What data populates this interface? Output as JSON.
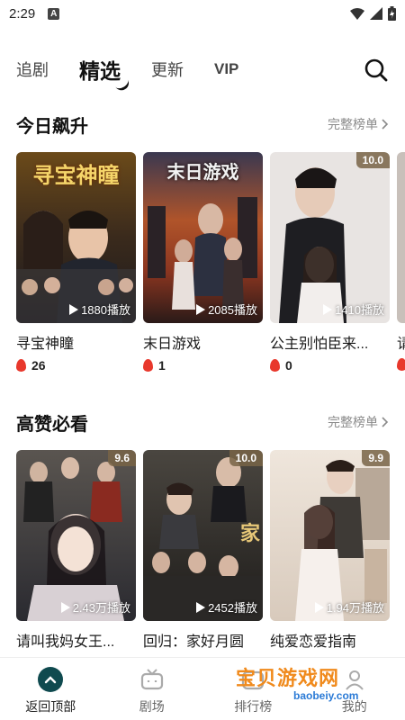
{
  "status": {
    "time": "2:29",
    "indicator": "A"
  },
  "tabs": [
    {
      "label": "追剧",
      "active": false
    },
    {
      "label": "精选",
      "active": true
    },
    {
      "label": "更新",
      "active": false
    },
    {
      "label": "VIP",
      "active": false
    }
  ],
  "sections": [
    {
      "title": "今日飙升",
      "more": "完整榜单",
      "cards": [
        {
          "title": "寻宝神瞳",
          "poster_text": "寻宝神瞳",
          "plays": "1880播放",
          "heat": "26",
          "badge": ""
        },
        {
          "title": "末日游戏",
          "poster_text": "末日游戏",
          "plays": "2085播放",
          "heat": "1",
          "badge": ""
        },
        {
          "title": "公主别怕臣来...",
          "poster_text": "",
          "plays": "1410播放",
          "heat": "0",
          "badge": "10.0"
        },
        {
          "title": "请",
          "poster_text": "",
          "plays": "",
          "heat": "",
          "badge": ""
        }
      ]
    },
    {
      "title": "高赞必看",
      "more": "完整榜单",
      "cards": [
        {
          "title": "请叫我妈女王...",
          "poster_text": "",
          "plays": "2.43万播放",
          "badge": "9.6"
        },
        {
          "title": "回归：家好月圆",
          "poster_text": "",
          "plays": "2452播放",
          "badge": "10.0"
        },
        {
          "title": "纯爱恋爱指南",
          "poster_text": "",
          "plays": "1.94万播放",
          "badge": "9.9"
        }
      ]
    }
  ],
  "bottom_nav": [
    {
      "label": "返回顶部",
      "icon": "up-arrow-icon",
      "active": true
    },
    {
      "label": "剧场",
      "icon": "tv-icon",
      "active": false
    },
    {
      "label": "排行榜",
      "icon": "ranking-icon",
      "active": false
    },
    {
      "label": "我的",
      "icon": "profile-icon",
      "active": false
    }
  ],
  "watermark": {
    "text": "宝贝游戏网",
    "url": "baobeiy.com"
  },
  "colors": {
    "accent": "#0f4a4f",
    "heat": "#e8382c",
    "watermark": "#f08a1c"
  }
}
